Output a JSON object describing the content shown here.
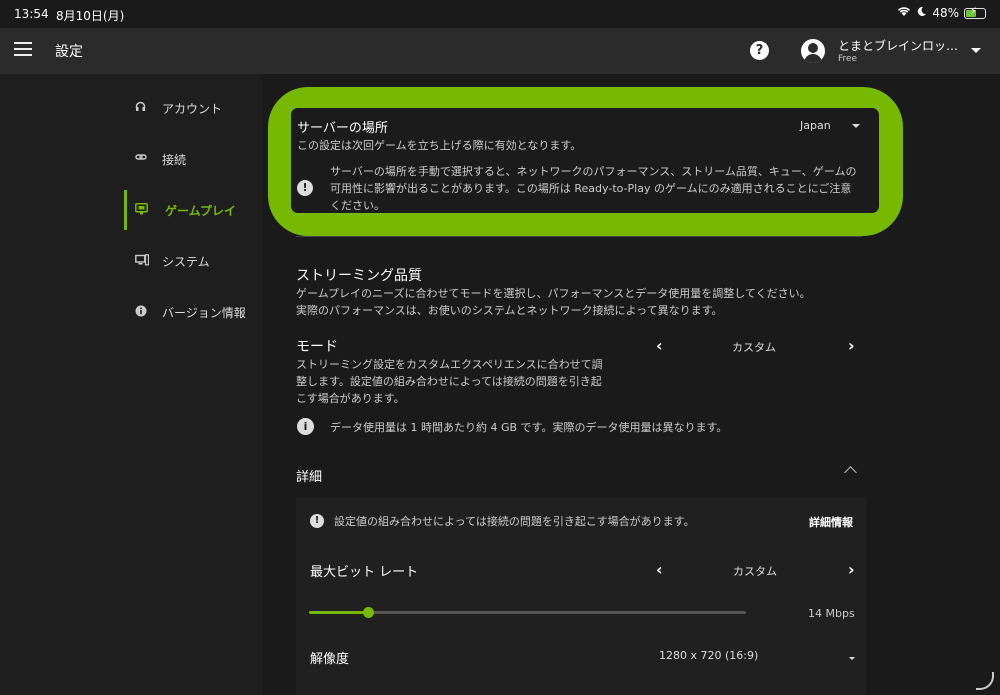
{
  "status_bar": {
    "time": "13:54",
    "date": "8月10日(月)",
    "battery": "48%",
    "battery_fraction": 0.48
  },
  "app_bar": {
    "title": "設定",
    "user_name": "とまとブレインロッ…",
    "user_plan": "Free"
  },
  "sidebar": {
    "items": [
      {
        "label": "アカウント",
        "icon": "headset-icon",
        "active": false
      },
      {
        "label": "接続",
        "icon": "link-icon",
        "active": false
      },
      {
        "label": "ゲームプレイ",
        "icon": "gameplay-monitor-icon",
        "active": true
      },
      {
        "label": "システム",
        "icon": "system-devices-icon",
        "active": false
      },
      {
        "label": "バージョン情報",
        "icon": "info-icon",
        "active": false
      }
    ]
  },
  "server": {
    "title": "サーバーの場所",
    "description": "この設定は次回ゲームを立ち上げる際に有効となります。",
    "selected": "Japan",
    "note": "サーバーの場所を手動で選択すると、ネットワークのパフォーマンス、ストリーム品質、キュー、ゲームの可用性に影響が出ることがあります。この場所は Ready-to-Play のゲームにのみ適用されることにご注意ください。"
  },
  "streaming": {
    "title": "ストリーミング品質",
    "description_line1": "ゲームプレイのニーズに合わせてモードを選択し、パフォーマンスとデータ使用量を調整してください。",
    "description_line2": "実際のパフォーマンスは、お使いのシステムとネットワーク接続によって異なります。",
    "mode": {
      "title": "モード",
      "description_line1": "ストリーミング設定をカスタムエクスペリエンスに合わせて調",
      "description_line2": "整します。設定値の組み合わせによっては接続の問題を引き起",
      "description_line3": "こす場合があります。",
      "value": "カスタム"
    },
    "data_usage_note": "データ使用量は 1 時間あたり約 4 GB です。実際のデータ使用量は異なります。"
  },
  "details": {
    "title": "詳細",
    "warning": "設定値の組み合わせによっては接続の問題を引き起こす場合があります。",
    "more_info": "詳細情報",
    "bitrate": {
      "label": "最大ビット レート",
      "value": "カスタム",
      "slider_value": "14 Mbps",
      "slider_fraction": 0.135
    },
    "resolution": {
      "label": "解像度",
      "value": "1280 x 720 (16:9)"
    }
  },
  "colors": {
    "accent": "#76b900",
    "background": "#1a1a1a",
    "app_bar": "#2b2b2b"
  }
}
